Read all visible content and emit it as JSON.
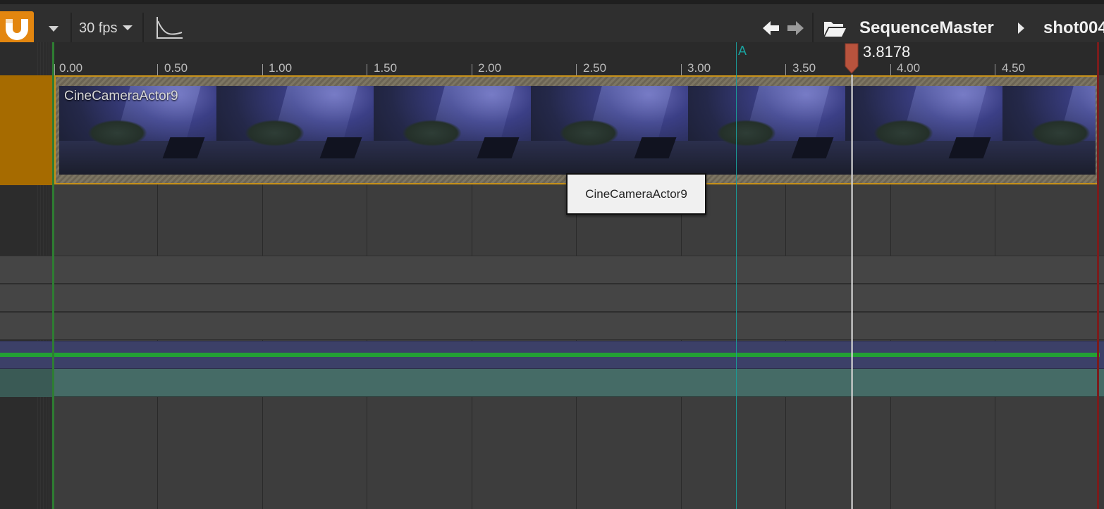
{
  "toolbar": {
    "snap_icon": "magnet-icon",
    "fps_label": "30 fps",
    "curve_icon": "curve-editor-icon",
    "back_icon": "arrow-left-icon",
    "forward_icon": "arrow-right-icon",
    "folder_icon": "folder-open-icon",
    "breadcrumb": [
      "SequenceMaster",
      "shot004"
    ]
  },
  "ruler": {
    "ticks": [
      "0.00",
      "0.50",
      "1.00",
      "1.50",
      "2.00",
      "2.50",
      "3.00",
      "3.50",
      "4.00",
      "4.50"
    ],
    "marker_label": "A",
    "playhead_time": "3.8178"
  },
  "camera_track": {
    "clip_label": "CineCameraActor9"
  },
  "tooltip": {
    "text": "CineCameraActor9"
  },
  "colors": {
    "accent": "#e3860f",
    "playhead": "#b8533d",
    "marker": "#1aa3a0",
    "camera_clip_border": "#c79119"
  }
}
